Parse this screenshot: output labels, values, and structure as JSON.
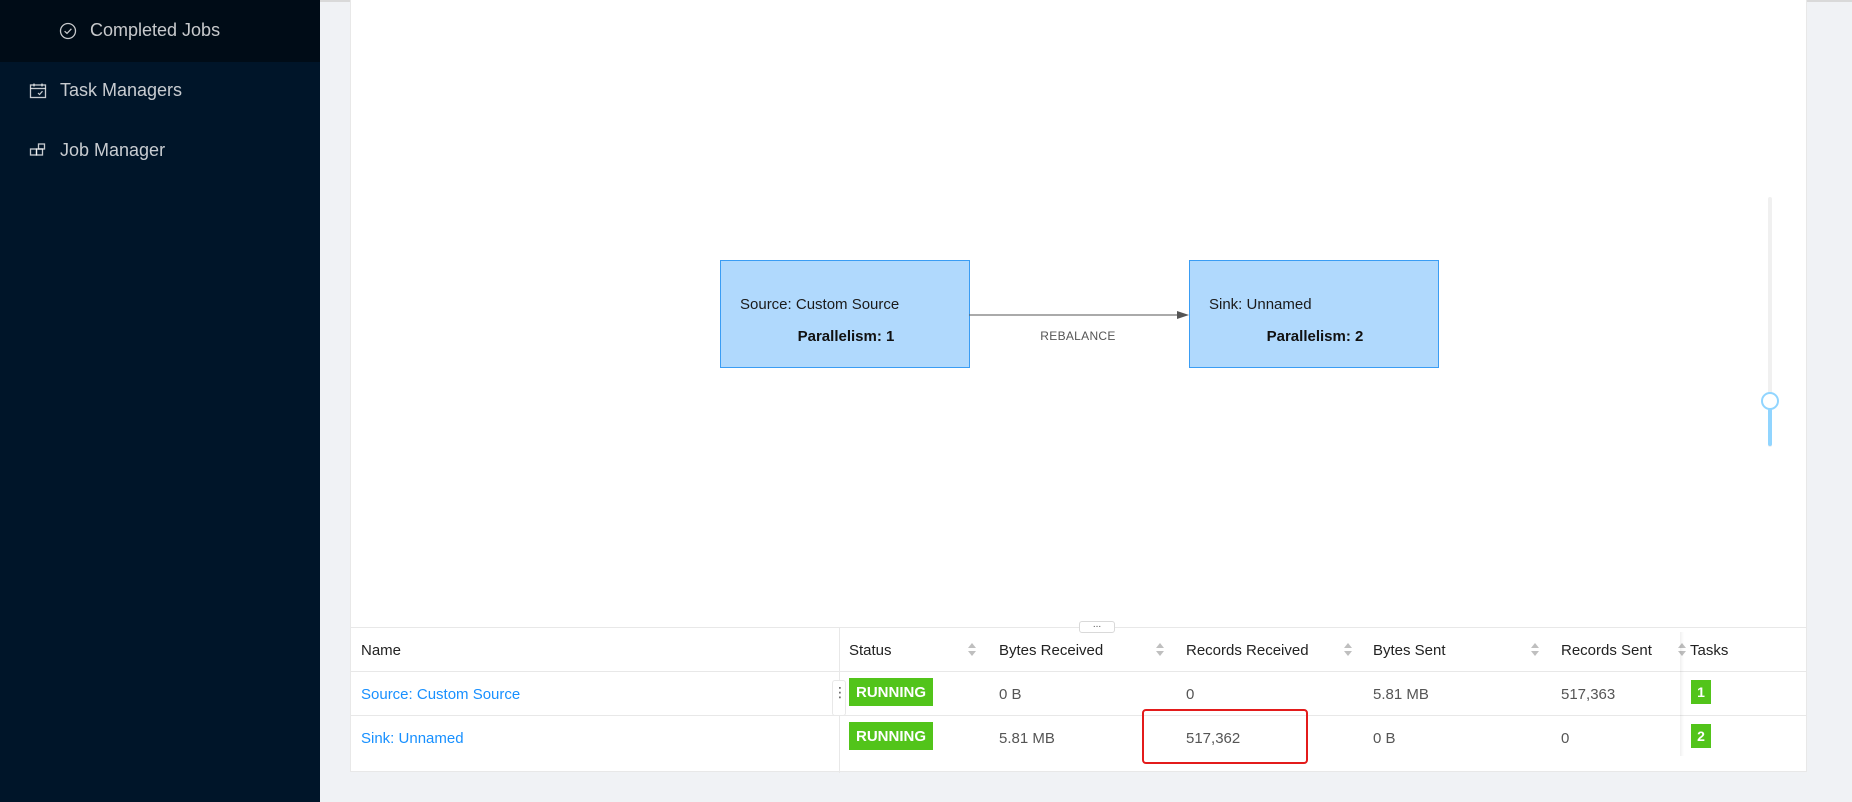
{
  "sidebar": {
    "items": [
      {
        "label": "Completed Jobs",
        "icon": "check-circle-icon"
      },
      {
        "label": "Task Managers",
        "icon": "schedule-icon"
      },
      {
        "label": "Job Manager",
        "icon": "build-icon"
      }
    ]
  },
  "graph": {
    "nodes": [
      {
        "name": "Source: Custom Source",
        "parallelism": "Parallelism: 1"
      },
      {
        "name": "Sink: Unnamed",
        "parallelism": "Parallelism: 2"
      }
    ],
    "edge_label": "REBALANCE",
    "colors": {
      "node_fill": "#b0d9fd",
      "node_border": "#3a9df4",
      "edge": "#555555"
    }
  },
  "resize_handle": "...",
  "table": {
    "headers": [
      "Name",
      "Status",
      "Bytes Received",
      "Records Received",
      "Bytes Sent",
      "Records Sent",
      "Tasks"
    ],
    "rows": [
      {
        "name": "Source: Custom Source",
        "status": "RUNNING",
        "bytes_received": "0 B",
        "records_received": "0",
        "bytes_sent": "5.81 MB",
        "records_sent": "517,363",
        "tasks": "1"
      },
      {
        "name": "Sink: Unnamed",
        "status": "RUNNING",
        "bytes_received": "5.81 MB",
        "records_received": "517,362",
        "bytes_sent": "0 B",
        "records_sent": "0",
        "tasks": "2"
      }
    ],
    "colors": {
      "status_running": "#52c41a",
      "link": "#1890ff",
      "highlight": "#e31b1b"
    }
  }
}
